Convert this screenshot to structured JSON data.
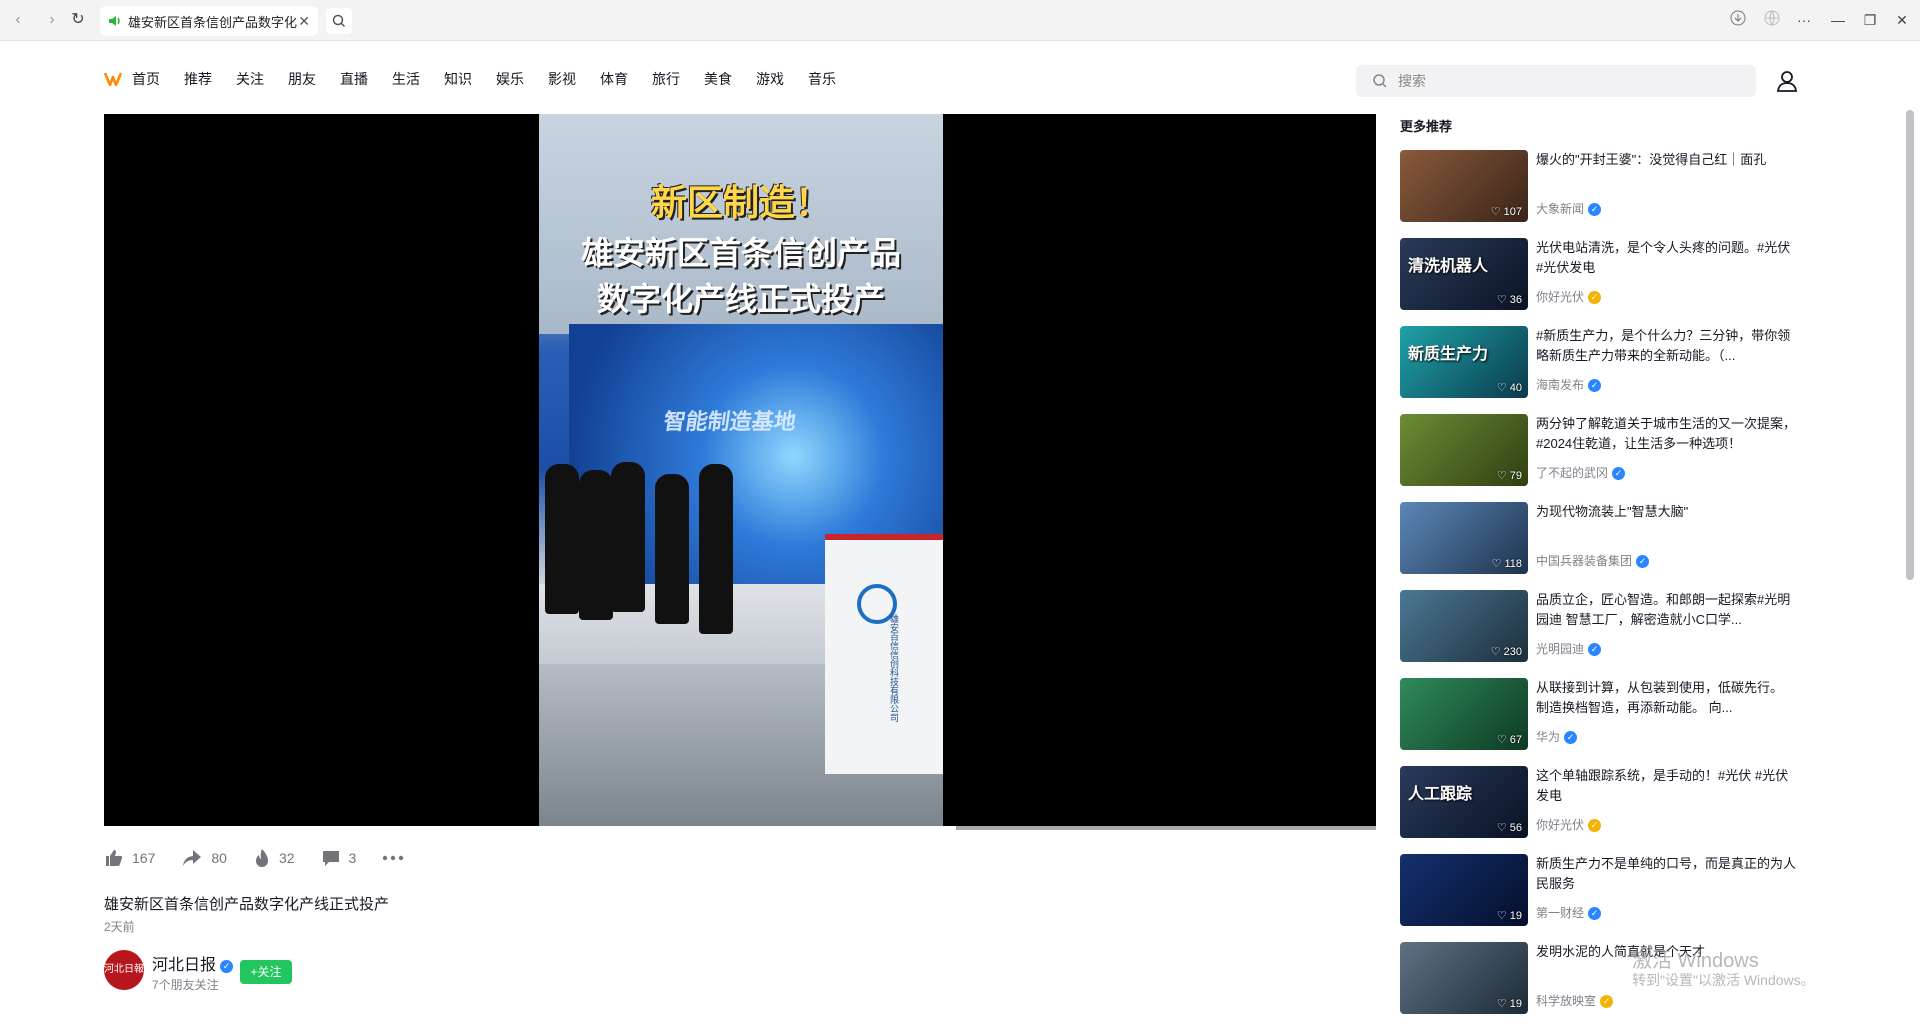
{
  "browser": {
    "tab_title": "雄安新区首条信创产品数字化",
    "back": "‹",
    "forward": "›",
    "reload": "↻",
    "menu": "···",
    "minimize": "—",
    "restore": "❐",
    "close": "✕"
  },
  "nav": {
    "items": [
      "首页",
      "推荐",
      "关注",
      "朋友",
      "直播",
      "生活",
      "知识",
      "娱乐",
      "影视",
      "体育",
      "旅行",
      "美食",
      "游戏",
      "音乐"
    ]
  },
  "search": {
    "placeholder": "搜索"
  },
  "video": {
    "caption_line1": "新区制造！",
    "caption_line2": "雄安新区首条信创产品",
    "caption_line3": "数字化产线正式投产",
    "screen_text": "智能制造基地",
    "podium_text": "雄安百信信创科技有限公司",
    "progress": 0.67
  },
  "actions": {
    "likes": "167",
    "shares": "80",
    "hot": "32",
    "comments": "3"
  },
  "details": {
    "title": "雄安新区首条信创产品数字化产线正式投产",
    "time": "2天前",
    "author": "河北日报",
    "author_avatar_text": "河北日報",
    "friends_follow": "7个朋友关注",
    "follow_label": "+关注"
  },
  "recommend": {
    "header": "更多推荐",
    "items": [
      {
        "text": "爆火的\"开封王婆\"：没觉得自己红｜面孔",
        "author": "大象新闻",
        "likes": "107",
        "badge": "blue",
        "thumb_label": "",
        "color1": "#8a5a3c",
        "color2": "#3a2418"
      },
      {
        "text": "光伏电站清洗，是个令人头疼的问题。#光伏 #光伏发电",
        "author": "你好光伏",
        "likes": "36",
        "badge": "gold",
        "thumb_label": "清洗机器人",
        "color1": "#2a3a58",
        "color2": "#0c1426"
      },
      {
        "text": "#新质生产力，是个什么力？三分钟，带你领略新质生产力带来的全新动能。（...",
        "author": "海南发布",
        "likes": "40",
        "badge": "blue",
        "thumb_label": "新质生产力",
        "color1": "#1ea3a8",
        "color2": "#0b3a4c"
      },
      {
        "text": "两分钟了解乾道关于城市生活的又一次提案，#2024住乾道，让生活多一种选项！",
        "author": "了不起的武冈",
        "likes": "79",
        "badge": "blue",
        "thumb_label": "",
        "color1": "#6d8c35",
        "color2": "#2f4012"
      },
      {
        "text": "为现代物流装上\"智慧大脑\"",
        "author": "中国兵器装备集团",
        "likes": "118",
        "badge": "blue",
        "thumb_label": "",
        "color1": "#5c87b8",
        "color2": "#1e344e"
      },
      {
        "text": "品质立企，匠心智造。和郎朗一起探索#光明园迪 智慧工厂，解密造就小C口学...",
        "author": "光明园迪",
        "likes": "230",
        "badge": "blue",
        "thumb_label": "",
        "color1": "#4c7894",
        "color2": "#1c2f3c"
      },
      {
        "text": "从联接到计算，从包装到使用，低碳先行。 制造换档智造，再添新动能。 向...",
        "author": "华为",
        "likes": "67",
        "badge": "blue",
        "thumb_label": "",
        "color1": "#2f8a5c",
        "color2": "#0e3a22"
      },
      {
        "text": "这个单轴跟踪系统，是手动的！#光伏 #光伏发电",
        "author": "你好光伏",
        "likes": "56",
        "badge": "gold",
        "thumb_label": "人工跟踪",
        "color1": "#2a3a5c",
        "color2": "#0a1224"
      },
      {
        "text": "新质生产力不是单纯的口号，而是真正的为人民服务",
        "author": "第一财经",
        "likes": "19",
        "badge": "blue",
        "thumb_label": "",
        "color1": "#14306e",
        "color2": "#050f2c"
      },
      {
        "text": "发明水泥的人简直就是个天才",
        "author": "科学放映室",
        "likes": "19",
        "badge": "gold",
        "thumb_label": "",
        "color1": "#5f7284",
        "color2": "#1e2a36"
      }
    ]
  },
  "watermark": {
    "line1": "激活 Windows",
    "line2": "转到\"设置\"以激活 Windows。"
  }
}
